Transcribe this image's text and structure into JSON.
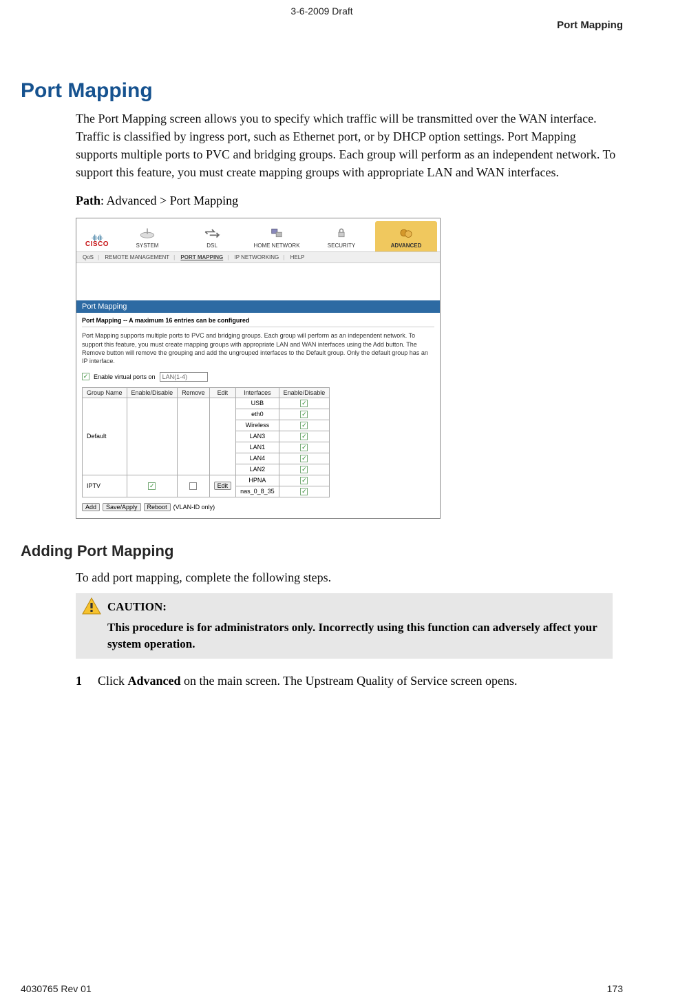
{
  "header": {
    "draft": "3-6-2009 Draft",
    "running": "Port Mapping"
  },
  "title": "Port Mapping",
  "intro": "The Port Mapping screen allows you to specify which traffic will be transmitted over the WAN interface. Traffic is classified by ingress port, such as Ethernet port, or by DHCP option settings. Port Mapping supports multiple ports to PVC and bridging groups. Each group will perform as an independent network. To support this feature, you must create mapping groups with appropriate LAN and WAN interfaces.",
  "path": {
    "label": "Path",
    "value": ":  Advanced > Port Mapping"
  },
  "screenshot": {
    "logo_brand": "CISCO",
    "nav": [
      "SYSTEM",
      "DSL",
      "HOME NETWORK",
      "SECURITY",
      "ADVANCED"
    ],
    "sub_tabs": [
      "QoS",
      "REMOTE MANAGEMENT",
      "PORT MAPPING",
      "IP NETWORKING",
      "HELP"
    ],
    "panel_title": "Port Mapping",
    "panel_sub": "Port Mapping -- A maximum 16 entries can be configured",
    "panel_desc": "Port Mapping supports multiple ports to PVC and bridging groups. Each group will perform as an independent network. To support this feature, you must create mapping groups with appropriate LAN and WAN interfaces using the Add button. The Remove button will remove the grouping and add the ungrouped interfaces to the Default group. Only the default group has an IP interface.",
    "enable_label": "Enable virtual ports on",
    "lan_select": "LAN(1-4)",
    "table_headers": [
      "Group Name",
      "Enable/Disable",
      "Remove",
      "Edit",
      "Interfaces",
      "Enable/Disable"
    ],
    "groups": [
      {
        "name": "Default",
        "enable": " ",
        "remove": " ",
        "edit": " ",
        "rows": [
          "USB",
          "eth0",
          "Wireless",
          "LAN3",
          "LAN1",
          "LAN4",
          "LAN2"
        ]
      },
      {
        "name": "IPTV",
        "enable": "✓",
        "remove": "☐",
        "edit": "Edit",
        "rows": [
          "HPNA",
          "nas_0_8_35"
        ]
      }
    ],
    "buttons": [
      "Add",
      "Save/Apply",
      "Reboot"
    ],
    "buttons_note": "(VLAN-ID only)"
  },
  "section2": {
    "title": "Adding Port Mapping",
    "lead": "To add port mapping, complete the following steps.",
    "caution_label": "CAUTION:",
    "caution_body": "This procedure is for administrators only. Incorrectly using this function can adversely affect your system operation.",
    "step1_num": "1",
    "step1_a": "Click ",
    "step1_b": "Advanced",
    "step1_c": " on the main screen. The Upstream Quality of Service screen opens."
  },
  "footer": {
    "left": "4030765 Rev 01",
    "right": "173"
  }
}
